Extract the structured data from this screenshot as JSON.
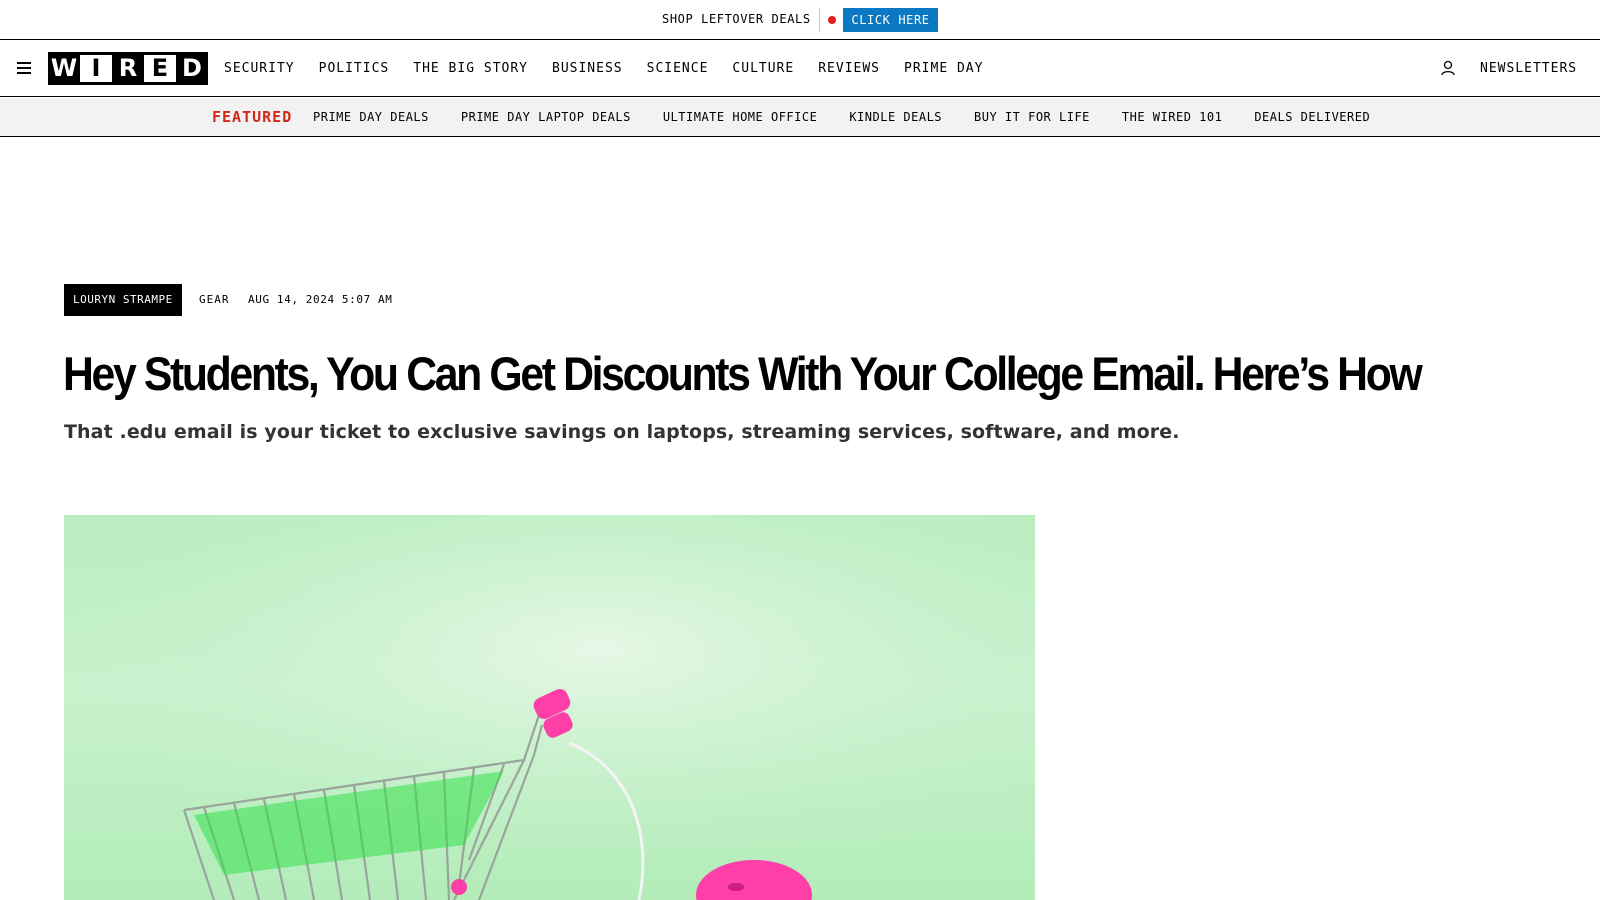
{
  "promo": {
    "text": "Shop Leftover Deals",
    "cta": "Click Here",
    "dot_color": "#e21b1b",
    "cta_color": "#0a78c2"
  },
  "nav": {
    "menu_icon": "hamburger-menu-icon",
    "logo_letters": [
      "W",
      "I",
      "R",
      "E",
      "D"
    ],
    "links": [
      "Security",
      "Politics",
      "The Big Story",
      "Business",
      "Science",
      "Culture",
      "Reviews",
      "Prime Day"
    ],
    "account_icon": "user-icon",
    "newsletters": "Newsletters"
  },
  "featured": {
    "label": "Featured",
    "label_color": "#d62618",
    "links": [
      "Prime Day Deals",
      "Prime Day Laptop Deals",
      "Ultimate Home Office",
      "Kindle Deals",
      "Buy It For Life",
      "The WIRED 101",
      "Deals Delivered"
    ]
  },
  "article": {
    "author": "Louryn Strampe",
    "rubric": "Gear",
    "date": "Aug 14, 2024 5:07 AM",
    "headline": "Hey Students, You Can Get Discounts With Your College Email. Here’s How",
    "dek": "That .edu email is your ticket to exclusive savings on laptops, streaming services, software, and more."
  },
  "hero_image": {
    "subject": "shopping-cart-with-computer-mouse",
    "background_color": "#c3f0c8",
    "accent_color": "#ff3fa8"
  }
}
